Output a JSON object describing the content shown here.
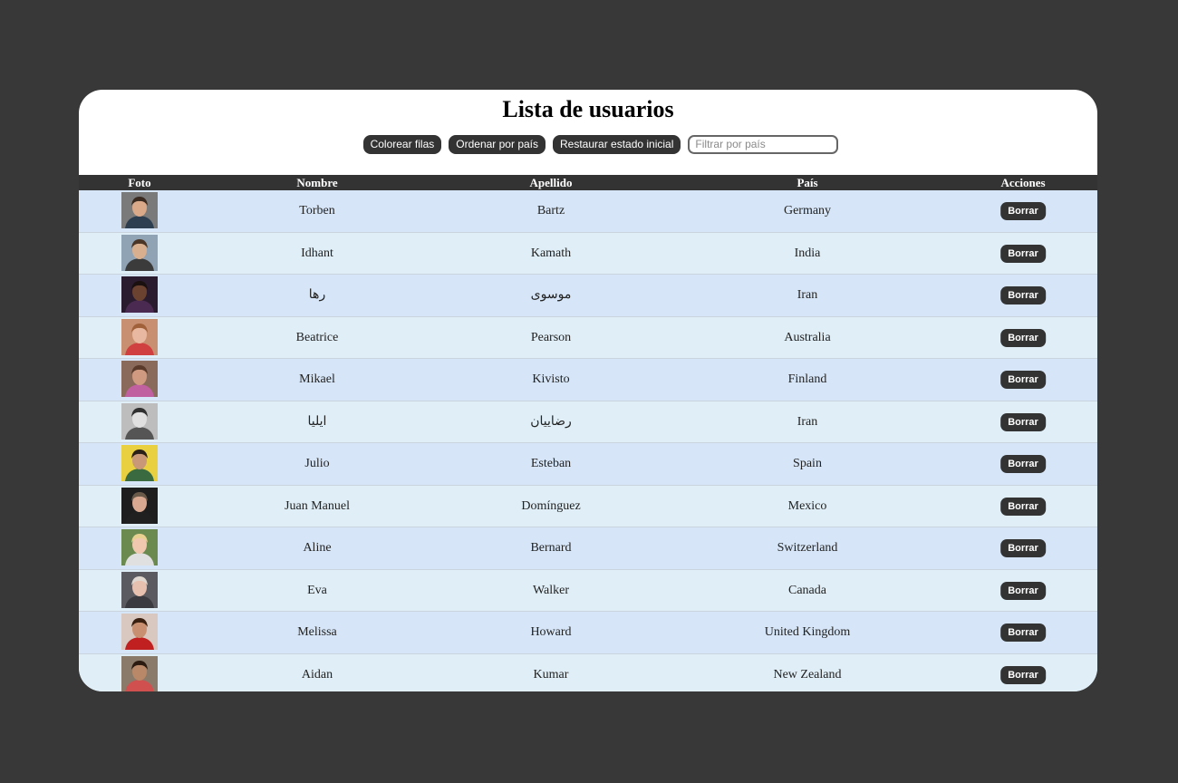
{
  "title": "Lista de usuarios",
  "toolbar": {
    "color_rows": "Colorear filas",
    "sort_country": "Ordenar por país",
    "reset": "Restaurar estado inicial",
    "filter_placeholder": "Filtrar por país"
  },
  "columns": {
    "photo": "Foto",
    "first": "Nombre",
    "last": "Apellido",
    "country": "País",
    "actions": "Acciones"
  },
  "delete_label": "Borrar",
  "colors": {
    "page_bg": "#383838",
    "header_bg": "#333333",
    "row_odd": "#d6e6f8",
    "row_even": "#dfeef7"
  },
  "users": [
    {
      "first": "Torben",
      "last": "Bartz",
      "country": "Germany",
      "avatar_bg": "#7a7a7a",
      "skin": "#d9a98a",
      "hair": "#3a2a20",
      "shirt": "#2c3e50"
    },
    {
      "first": "Idhant",
      "last": "Kamath",
      "country": "India",
      "avatar_bg": "#8fa3b5",
      "skin": "#d8b08f",
      "hair": "#4a3526",
      "shirt": "#3b3b3b"
    },
    {
      "first": "رها",
      "last": "موسوی",
      "country": "Iran",
      "avatar_bg": "#2a1b2e",
      "skin": "#6b4230",
      "hair": "#1a1010",
      "shirt": "#4a2a50"
    },
    {
      "first": "Beatrice",
      "last": "Pearson",
      "country": "Australia",
      "avatar_bg": "#c89070",
      "skin": "#e8b8a0",
      "hair": "#a0603a",
      "shirt": "#d04040"
    },
    {
      "first": "Mikael",
      "last": "Kivisto",
      "country": "Finland",
      "avatar_bg": "#8a6a5a",
      "skin": "#d09a80",
      "hair": "#5a3a2a",
      "shirt": "#c060a0"
    },
    {
      "first": "ایلیا",
      "last": "رضاییان",
      "country": "Iran",
      "avatar_bg": "#bdbdbd",
      "skin": "#e0e0e0",
      "hair": "#303030",
      "shirt": "#555555"
    },
    {
      "first": "Julio",
      "last": "Esteban",
      "country": "Spain",
      "avatar_bg": "#e8d040",
      "skin": "#c89878",
      "hair": "#2a2018",
      "shirt": "#3a6a40"
    },
    {
      "first": "Juan Manuel",
      "last": "Domínguez",
      "country": "Mexico",
      "avatar_bg": "#1e1e1e",
      "skin": "#d8a890",
      "hair": "#6a5a4a",
      "shirt": "#202020"
    },
    {
      "first": "Aline",
      "last": "Bernard",
      "country": "Switzerland",
      "avatar_bg": "#6a8a50",
      "skin": "#f0c8b0",
      "hair": "#e8d090",
      "shirt": "#e0e0e0"
    },
    {
      "first": "Eva",
      "last": "Walker",
      "country": "Canada",
      "avatar_bg": "#5a5a60",
      "skin": "#e8c0b0",
      "hair": "#e0d8d0",
      "shirt": "#3a3a40"
    },
    {
      "first": "Melissa",
      "last": "Howard",
      "country": "United Kingdom",
      "avatar_bg": "#d8c8c0",
      "skin": "#c89070",
      "hair": "#3a2010",
      "shirt": "#c02020"
    },
    {
      "first": "Aidan",
      "last": "Kumar",
      "country": "New Zealand",
      "avatar_bg": "#8a7a6a",
      "skin": "#b88868",
      "hair": "#2a1a10",
      "shirt": "#d05050"
    }
  ]
}
